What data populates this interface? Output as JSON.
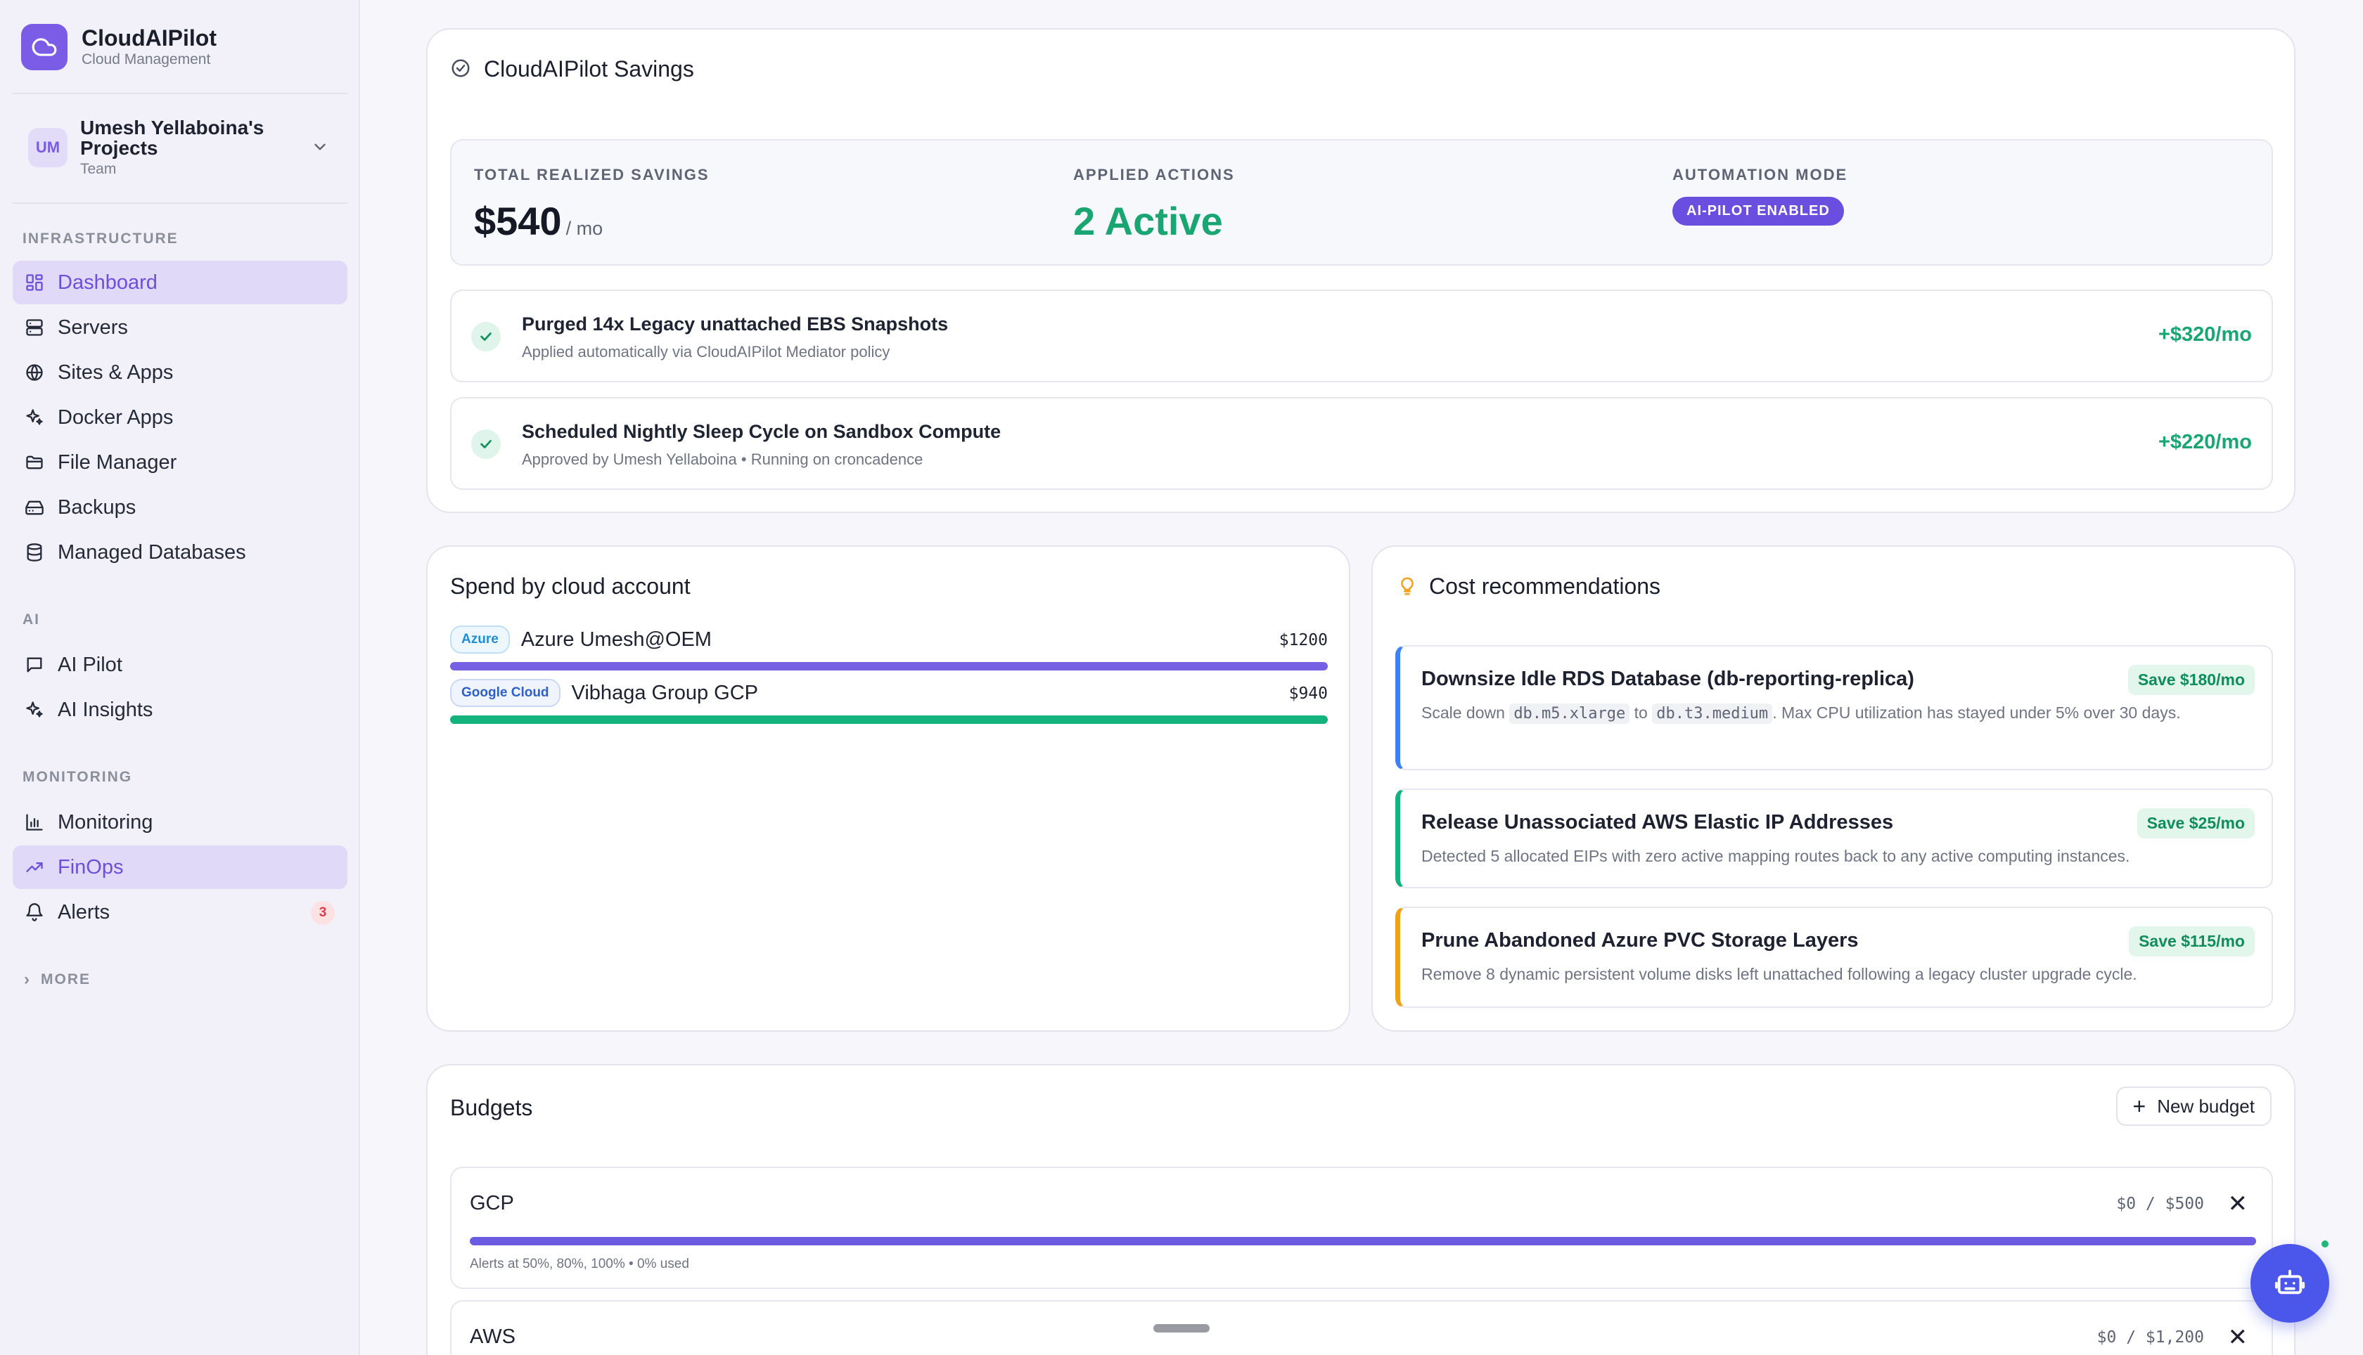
{
  "colors": {
    "accent": "#6a4ee0",
    "green": "#19a672",
    "azure": "#7660e4",
    "gcp": "#14b37e",
    "rec_blue": "#3b82f6",
    "rec_green": "#14b37e",
    "rec_amber": "#f2a11b"
  },
  "brand": {
    "name": "CloudAIPilot",
    "subtitle": "Cloud Management"
  },
  "project": {
    "initials": "UM",
    "name": "Umesh Yellaboina's Projects",
    "type": "Team"
  },
  "sidebar": {
    "sections": {
      "infrastructure": "INFRASTRUCTURE",
      "ai": "AI",
      "monitoring": "MONITORING"
    },
    "items": [
      {
        "label": "Dashboard",
        "icon": "dashboard-icon"
      },
      {
        "label": "Servers",
        "icon": "server-icon"
      },
      {
        "label": "Sites & Apps",
        "icon": "globe-icon"
      },
      {
        "label": "Docker Apps",
        "icon": "sparkle-icon"
      },
      {
        "label": "File Manager",
        "icon": "folder-icon"
      },
      {
        "label": "Backups",
        "icon": "drive-icon"
      },
      {
        "label": "Managed Databases",
        "icon": "database-icon"
      },
      {
        "label": "AI Pilot",
        "icon": "chat-icon"
      },
      {
        "label": "AI Insights",
        "icon": "sparkle-icon"
      },
      {
        "label": "Monitoring",
        "icon": "bar-chart-icon"
      },
      {
        "label": "FinOps",
        "icon": "trend-up-icon"
      },
      {
        "label": "Alerts",
        "icon": "bell-icon",
        "badge": "3"
      }
    ],
    "more": "MORE"
  },
  "savings": {
    "title": "CloudAIPilot Savings",
    "total_label": "TOTAL REALIZED SAVINGS",
    "total_value": "$540",
    "total_unit": "/ mo",
    "applied_label": "APPLIED ACTIONS",
    "applied_value": "2 Active",
    "mode_label": "AUTOMATION MODE",
    "mode_value": "AI-PILOT ENABLED",
    "actions": [
      {
        "title": "Purged 14x Legacy unattached EBS Snapshots",
        "subtitle": "Applied automatically via CloudAIPilot Mediator policy",
        "amount": "+$320/mo"
      },
      {
        "title": "Scheduled Nightly Sleep Cycle on Sandbox Compute",
        "subtitle": "Approved by Umesh Yellaboina • Running on croncadence",
        "amount": "+$220/mo"
      }
    ]
  },
  "spend": {
    "title": "Spend by cloud account",
    "accounts": [
      {
        "tag": "Azure",
        "name": "Azure Umesh@OEM",
        "amount": "$1200",
        "share": 1.0
      },
      {
        "tag": "Google Cloud",
        "name": "Vibhaga Group GCP",
        "amount": "$940",
        "share": 1.0
      }
    ]
  },
  "recommendations": {
    "title": "Cost recommendations",
    "items": [
      {
        "title": "Downsize Idle RDS Database (db-reporting-replica)",
        "save": "Save $180/mo",
        "desc_pre": "Scale down ",
        "code1": "db.m5.xlarge",
        "desc_mid": " to ",
        "code2": "db.t3.medium",
        "desc_post": ". Max CPU utilization has stayed under 5% over 30 days."
      },
      {
        "title": "Release Unassociated AWS Elastic IP Addresses",
        "save": "Save $25/mo",
        "desc": "Detected 5 allocated EIPs with zero active mapping routes back to any active computing instances."
      },
      {
        "title": "Prune Abandoned Azure PVC Storage Layers",
        "save": "Save $115/mo",
        "desc": "Remove 8 dynamic persistent volume disks left unattached following a legacy cluster upgrade cycle."
      }
    ]
  },
  "budgets": {
    "title": "Budgets",
    "new_label": "New budget",
    "items": [
      {
        "name": "GCP",
        "amount": "$0 / $500",
        "note": "Alerts at 50%, 80%, 100% • 0% used"
      },
      {
        "name": "AWS",
        "amount": "$0 / $1,200"
      }
    ]
  }
}
